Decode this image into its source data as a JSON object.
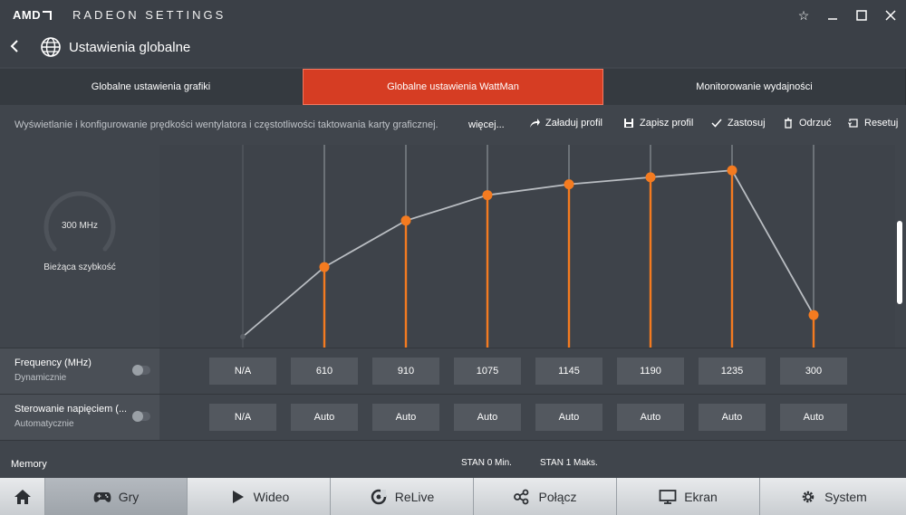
{
  "brand": {
    "name": "AMD"
  },
  "app": {
    "title": "RADEON SETTINGS"
  },
  "header": {
    "title": "Ustawienia globalne"
  },
  "tabs": [
    {
      "label": "Globalne ustawienia grafiki"
    },
    {
      "label": "Globalne ustawienia WattMan",
      "active": true
    },
    {
      "label": "Monitorowanie wydajności"
    }
  ],
  "toolbar": {
    "description": "Wyświetlanie i konfigurowanie prędkości wentylatora i częstotliwości taktowania karty graficznej.",
    "more": "więcej...",
    "load": "Załaduj profil",
    "save": "Zapisz profil",
    "apply": "Zastosuj",
    "discard": "Odrzuć",
    "reset": "Resetuj"
  },
  "gauge": {
    "value": "300 MHz",
    "label": "Bieżąca szybkość"
  },
  "accent": "#f47b20",
  "chart_data": {
    "type": "line",
    "categories": [
      "0",
      "1",
      "2",
      "3",
      "4",
      "5",
      "6",
      "7"
    ],
    "series": [
      {
        "values": [
          null,
          610,
          910,
          1075,
          1145,
          1190,
          1235,
          300
        ]
      }
    ],
    "ylim": [
      160,
      1400
    ]
  },
  "frequency": {
    "title": "Frequency (MHz)",
    "subtitle": "Dynamicznie",
    "values": [
      "N/A",
      "610",
      "910",
      "1075",
      "1145",
      "1190",
      "1235",
      "300"
    ]
  },
  "voltage": {
    "title": "Sterowanie napięciem (...",
    "subtitle": "Automatycznie",
    "values": [
      "N/A",
      "Auto",
      "Auto",
      "Auto",
      "Auto",
      "Auto",
      "Auto",
      "Auto"
    ]
  },
  "memory": {
    "title": "Memory",
    "state0": "STAN 0 Min.",
    "state1": "STAN 1 Maks."
  },
  "nav": [
    {
      "label": "",
      "icon": "home-icon"
    },
    {
      "label": "Gry",
      "icon": "gamepad-icon",
      "active": true
    },
    {
      "label": "Wideo",
      "icon": "play-icon"
    },
    {
      "label": "ReLive",
      "icon": "relive-icon"
    },
    {
      "label": "Połącz",
      "icon": "connect-icon"
    },
    {
      "label": "Ekran",
      "icon": "monitor-icon"
    },
    {
      "label": "System",
      "icon": "gear-icon"
    }
  ]
}
